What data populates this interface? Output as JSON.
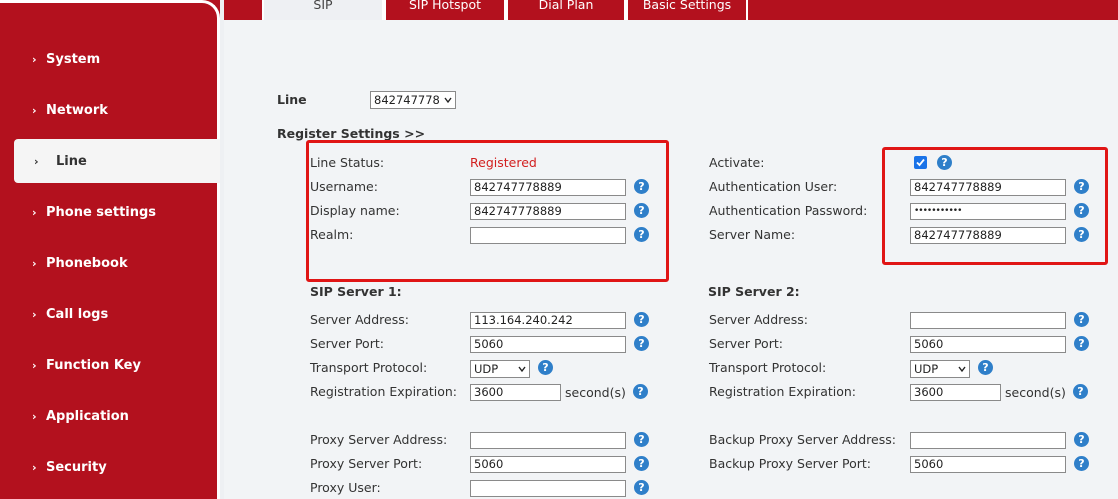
{
  "sidebar": {
    "items": [
      {
        "label": "System"
      },
      {
        "label": "Network"
      },
      {
        "label": "Line"
      },
      {
        "label": "Phone settings"
      },
      {
        "label": "Phonebook"
      },
      {
        "label": "Call logs"
      },
      {
        "label": "Function Key"
      },
      {
        "label": "Application"
      },
      {
        "label": "Security"
      }
    ],
    "active": "Line"
  },
  "tabs": [
    {
      "label": "SIP",
      "active": true
    },
    {
      "label": "SIP Hotspot",
      "active": false
    },
    {
      "label": "Dial Plan",
      "active": false
    },
    {
      "label": "Basic Settings",
      "active": false
    }
  ],
  "line": {
    "label": "Line",
    "selected": "842747778"
  },
  "register": {
    "heading": "Register Settings >>",
    "line_status_label": "Line Status:",
    "line_status_value": "Registered",
    "username_label": "Username:",
    "username_value": "842747778889",
    "display_name_label": "Display name:",
    "display_name_value": "842747778889",
    "realm_label": "Realm:",
    "realm_value": "",
    "activate_label": "Activate:",
    "activate_checked": true,
    "auth_user_label": "Authentication User:",
    "auth_user_value": "842747778889",
    "auth_password_label": "Authentication Password:",
    "auth_password_value": "•••••••••••",
    "server_name_label": "Server Name:",
    "server_name_value": "842747778889"
  },
  "sip1": {
    "heading": "SIP Server 1:",
    "server_address_label": "Server Address:",
    "server_address_value": "113.164.240.242",
    "server_port_label": "Server Port:",
    "server_port_value": "5060",
    "transport_label": "Transport Protocol:",
    "transport_value": "UDP",
    "expiration_label": "Registration Expiration:",
    "expiration_value": "3600",
    "seconds_label": "second(s)"
  },
  "sip2": {
    "heading": "SIP Server 2:",
    "server_address_label": "Server Address:",
    "server_address_value": "",
    "server_port_label": "Server Port:",
    "server_port_value": "5060",
    "transport_label": "Transport Protocol:",
    "transport_value": "UDP",
    "expiration_label": "Registration Expiration:",
    "expiration_value": "3600",
    "seconds_label": "second(s)"
  },
  "proxy": {
    "proxy_address_label": "Proxy Server Address:",
    "proxy_address_value": "",
    "proxy_port_label": "Proxy Server Port:",
    "proxy_port_value": "5060",
    "proxy_user_label": "Proxy User:",
    "proxy_user_value": "",
    "backup_address_label": "Backup Proxy Server Address:",
    "backup_address_value": "",
    "backup_port_label": "Backup Proxy Server Port:",
    "backup_port_value": "5060"
  },
  "help_glyph": "?",
  "chevron_glyph": "›",
  "colors": {
    "brand": "#b3111e",
    "highlight": "#e01515",
    "help": "#2f7fc9",
    "status": "#d21f1f"
  }
}
